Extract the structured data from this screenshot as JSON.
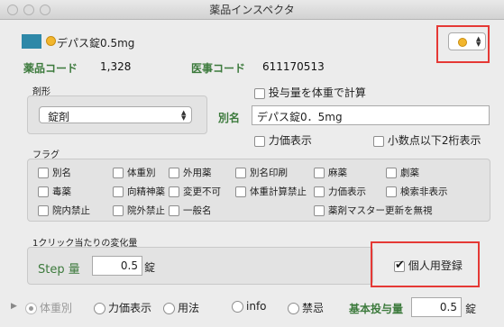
{
  "window": {
    "title": "薬品インスペクタ"
  },
  "header": {
    "drug_name": "デパス錠0.5mg",
    "color_swatch": "#2e88a8",
    "dot_color": "#f2b62d"
  },
  "codes": {
    "drug_code_label": "薬品コード",
    "drug_code_value": "1,328",
    "medical_code_label": "医事コード",
    "medical_code_value": "611170513"
  },
  "form": {
    "dosage_form_label": "剤形",
    "dosage_form_value": "錠剤",
    "weight_dose_label": "投与量を体重で計算",
    "alias_label": "別名",
    "alias_value": "デパス錠0．5mg",
    "potency_label": "力価表示",
    "decimal_label": "小数点以下2桁表示"
  },
  "flags": {
    "title": "フラグ",
    "items": [
      "別名",
      "体重別",
      "外用薬",
      "別名印刷",
      "麻薬",
      "劇薬",
      "毒薬",
      "向精神薬",
      "変更不可",
      "体重計算禁止",
      "力価表示",
      "検索非表示",
      "院内禁止",
      "院外禁止",
      "一般名",
      "薬剤マスター更新を無視"
    ]
  },
  "change": {
    "title": "1クリック当たりの変化量",
    "step_label": "Step 量",
    "step_value": "0.5",
    "step_unit": "錠",
    "personal_label": "個人用登録"
  },
  "bottom": {
    "options": [
      "体重別",
      "力価表示",
      "用法",
      "info",
      "禁忌"
    ],
    "base_dose_label": "基本投与量",
    "base_dose_value": "0.5",
    "base_dose_unit": "錠"
  }
}
